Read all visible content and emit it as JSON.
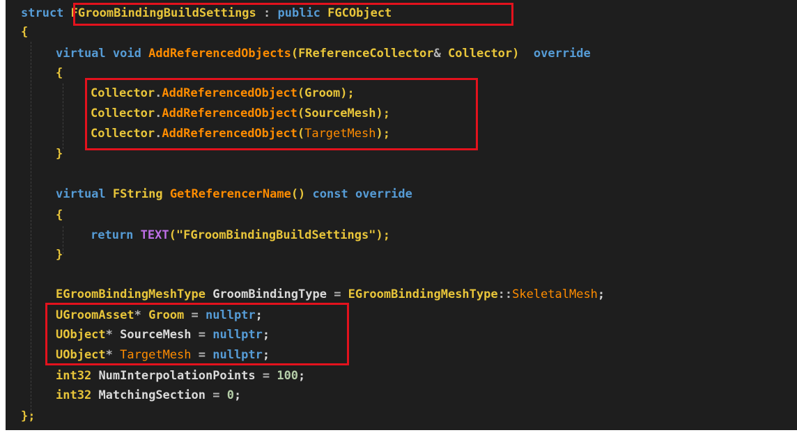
{
  "code": {
    "l1": {
      "kw_struct": "struct",
      "name": "FGroomBindingBuildSettings",
      "sep": " : ",
      "kw_public": "public",
      "base": "FGCObject"
    },
    "l2": {
      "brace": "{"
    },
    "l3": {
      "kw_virtual": "virtual",
      "kw_void": "void",
      "fn": "AddReferencedObjects",
      "paren_open": "(",
      "type": "FReferenceCollector",
      "amp": "&",
      "param": "Collector",
      "paren_close": ")",
      "kw_override": "override"
    },
    "l4": {
      "brace": "{"
    },
    "l5": {
      "obj": "Collector",
      "dot": ".",
      "fn": "AddReferencedObject",
      "open": "(",
      "arg": "Groom",
      "close": ");"
    },
    "l6": {
      "obj": "Collector",
      "dot": ".",
      "fn": "AddReferencedObject",
      "open": "(",
      "arg": "SourceMesh",
      "close": ");"
    },
    "l7": {
      "obj": "Collector",
      "dot": ".",
      "fn": "AddReferencedObject",
      "open": "(",
      "arg": "TargetMesh",
      "close": ");"
    },
    "l8": {
      "brace": "}"
    },
    "l10": {
      "kw_virtual": "virtual",
      "type": "FString",
      "fn": "GetReferencerName",
      "parens": "()",
      "kw_const": "const",
      "kw_override": "override"
    },
    "l11": {
      "brace": "{"
    },
    "l12": {
      "kw_return": "return",
      "macro": "TEXT",
      "open": "(",
      "str": "\"FGroomBindingBuildSettings\"",
      "close": ");"
    },
    "l13": {
      "brace": "}"
    },
    "l15": {
      "type": "EGroomBindingMeshType",
      "var": "GroomBindingType",
      "eq": " = ",
      "type2": "EGroomBindingMeshType",
      "scope": "::",
      "enum": "SkeletalMesh",
      "semi": ";"
    },
    "l16": {
      "type": "UGroomAsset",
      "star": "*",
      "var": "Groom",
      "eq": " = ",
      "kw_null": "nullptr",
      "semi": ";"
    },
    "l17": {
      "type": "UObject",
      "star": "*",
      "var": "SourceMesh",
      "eq": " = ",
      "kw_null": "nullptr",
      "semi": ";"
    },
    "l18": {
      "type": "UObject",
      "star": "*",
      "var": "TargetMesh",
      "eq": " = ",
      "kw_null": "nullptr",
      "semi": ";"
    },
    "l19": {
      "type": "int32",
      "var": "NumInterpolationPoints",
      "eq": " = ",
      "num": "100",
      "semi": ";"
    },
    "l20": {
      "type": "int32",
      "var": "MatchingSection",
      "eq": " = ",
      "num": "0",
      "semi": ";"
    },
    "l21": {
      "close": "};"
    }
  }
}
